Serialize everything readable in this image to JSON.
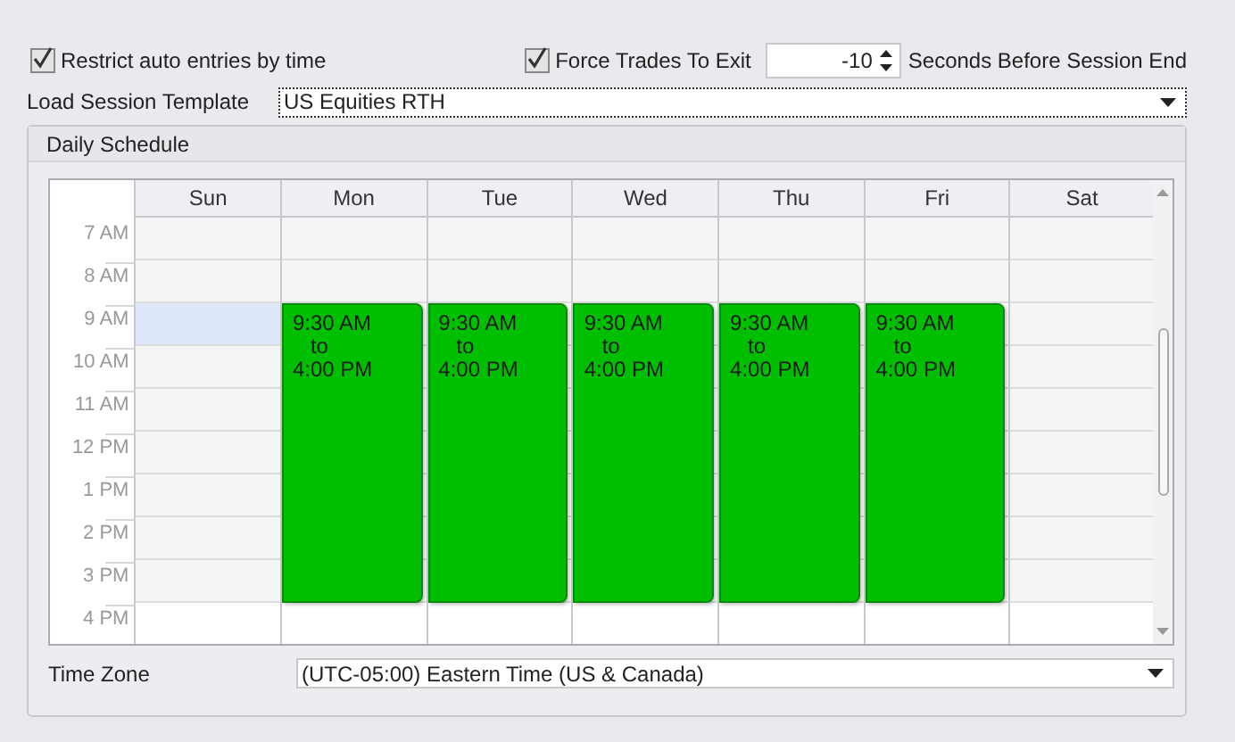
{
  "restrict_entries": {
    "label": "Restrict auto entries by time",
    "checked": true
  },
  "force_exit": {
    "label": "Force Trades To Exit",
    "checked": true,
    "value": "-10",
    "suffix": "Seconds Before Session End"
  },
  "session_template": {
    "label": "Load Session Template",
    "value": "US Equities RTH"
  },
  "daily_schedule": {
    "title": "Daily Schedule",
    "hours": [
      "7 AM",
      "8 AM",
      "9 AM",
      "10 AM",
      "11 AM",
      "12 PM",
      "1 PM",
      "2 PM",
      "3 PM",
      "4 PM"
    ],
    "days": [
      {
        "label": "Sun",
        "slots": [
          {
            "kind": "off"
          },
          {
            "kind": "off"
          },
          {
            "kind": "selected"
          },
          {
            "kind": "off"
          },
          {
            "kind": "off"
          },
          {
            "kind": "off"
          },
          {
            "kind": "off"
          },
          {
            "kind": "off"
          },
          {
            "kind": "off"
          },
          {
            "kind": "free"
          }
        ]
      },
      {
        "label": "Mon",
        "slots": [
          {
            "kind": "off"
          },
          {
            "kind": "off"
          },
          {
            "kind": "session"
          },
          {
            "kind": "session"
          },
          {
            "kind": "session"
          },
          {
            "kind": "session"
          },
          {
            "kind": "session"
          },
          {
            "kind": "session"
          },
          {
            "kind": "session"
          },
          {
            "kind": "free"
          }
        ],
        "session": {
          "from": "9:30 AM",
          "sep": "to",
          "to": "4:00 PM"
        }
      },
      {
        "label": "Tue",
        "slots": [
          {
            "kind": "off"
          },
          {
            "kind": "off"
          },
          {
            "kind": "session"
          },
          {
            "kind": "session"
          },
          {
            "kind": "session"
          },
          {
            "kind": "session"
          },
          {
            "kind": "session"
          },
          {
            "kind": "session"
          },
          {
            "kind": "session"
          },
          {
            "kind": "free"
          }
        ],
        "session": {
          "from": "9:30 AM",
          "sep": "to",
          "to": "4:00 PM"
        }
      },
      {
        "label": "Wed",
        "slots": [
          {
            "kind": "off"
          },
          {
            "kind": "off"
          },
          {
            "kind": "session"
          },
          {
            "kind": "session"
          },
          {
            "kind": "session"
          },
          {
            "kind": "session"
          },
          {
            "kind": "session"
          },
          {
            "kind": "session"
          },
          {
            "kind": "session"
          },
          {
            "kind": "free"
          }
        ],
        "session": {
          "from": "9:30 AM",
          "sep": "to",
          "to": "4:00 PM"
        }
      },
      {
        "label": "Thu",
        "slots": [
          {
            "kind": "off"
          },
          {
            "kind": "off"
          },
          {
            "kind": "session"
          },
          {
            "kind": "session"
          },
          {
            "kind": "session"
          },
          {
            "kind": "session"
          },
          {
            "kind": "session"
          },
          {
            "kind": "session"
          },
          {
            "kind": "session"
          },
          {
            "kind": "free"
          }
        ],
        "session": {
          "from": "9:30 AM",
          "sep": "to",
          "to": "4:00 PM"
        }
      },
      {
        "label": "Fri",
        "slots": [
          {
            "kind": "off"
          },
          {
            "kind": "off"
          },
          {
            "kind": "session"
          },
          {
            "kind": "session"
          },
          {
            "kind": "session"
          },
          {
            "kind": "session"
          },
          {
            "kind": "session"
          },
          {
            "kind": "session"
          },
          {
            "kind": "session"
          },
          {
            "kind": "free"
          }
        ],
        "session": {
          "from": "9:30 AM",
          "sep": "to",
          "to": "4:00 PM"
        }
      },
      {
        "label": "Sat",
        "slots": [
          {
            "kind": "off"
          },
          {
            "kind": "off"
          },
          {
            "kind": "off"
          },
          {
            "kind": "off"
          },
          {
            "kind": "off"
          },
          {
            "kind": "off"
          },
          {
            "kind": "off"
          },
          {
            "kind": "off"
          },
          {
            "kind": "off"
          },
          {
            "kind": "free"
          }
        ]
      }
    ]
  },
  "time_zone": {
    "label": "Time Zone",
    "value": "(UTC-05:00) Eastern Time (US & Canada)"
  }
}
